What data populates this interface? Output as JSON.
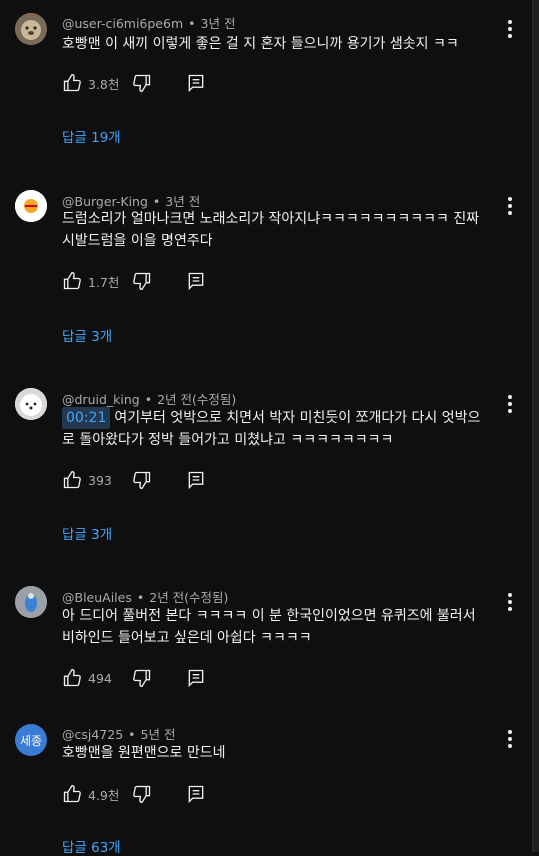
{
  "comments": [
    {
      "author": "@user-ci6mi6pe6m",
      "time": "3년 전",
      "text": "호빵맨 이 새끼 이렇게 좋은 걸 지 혼자 들으니까 용기가 샘솟지 ㅋㅋ",
      "likes": "3.8천",
      "replies": "답글 19개"
    },
    {
      "author": "@Burger-King",
      "time": "3년 전",
      "text": "드럼소리가 얼마나크면 노래소리가 작아지냐ㅋㅋㅋㅋㅋㅋㅋㅋㅋㅋ 진짜 시발드럼을 이을 명연주다",
      "likes": "1.7천",
      "replies": "답글 3개"
    },
    {
      "author": "@druid_king",
      "time": "2년 전(수정됨)",
      "timestamp": "00:21",
      "text": "여기부터 엇박으로 치면서 박자 미친듯이 쪼개다가 다시 엇박으로 돌아왔다가 정박 들어가고 미쳤냐고 ㅋㅋㅋㅋㅋㅋㅋㅋ",
      "likes": "393",
      "replies": "답글 3개"
    },
    {
      "author": "@BleuAiles",
      "time": "2년 전(수정됨)",
      "text": "아 드디어 풀버전 본다 ㅋㅋㅋㅋ 이 분 한국인이었으면 유퀴즈에 불러서 비하인드 들어보고 싶은데 아쉽다 ㅋㅋㅋㅋ",
      "likes": "494"
    },
    {
      "author": "@csj4725",
      "time": "5년 전",
      "avatar_text": "세종",
      "text": "호빵맨을 원편맨으로 만드네",
      "likes": "4.9천",
      "replies": "답글 63개"
    }
  ],
  "colors": {
    "background": "#0f0f0f",
    "link": "#3ea6ff",
    "meta": "#aaaaaa",
    "text": "#f1f1f1",
    "avatar_csj": "#3a7bd5"
  },
  "icons": [
    "like-icon",
    "dislike-icon",
    "reply-icon",
    "more-vert-icon"
  ]
}
